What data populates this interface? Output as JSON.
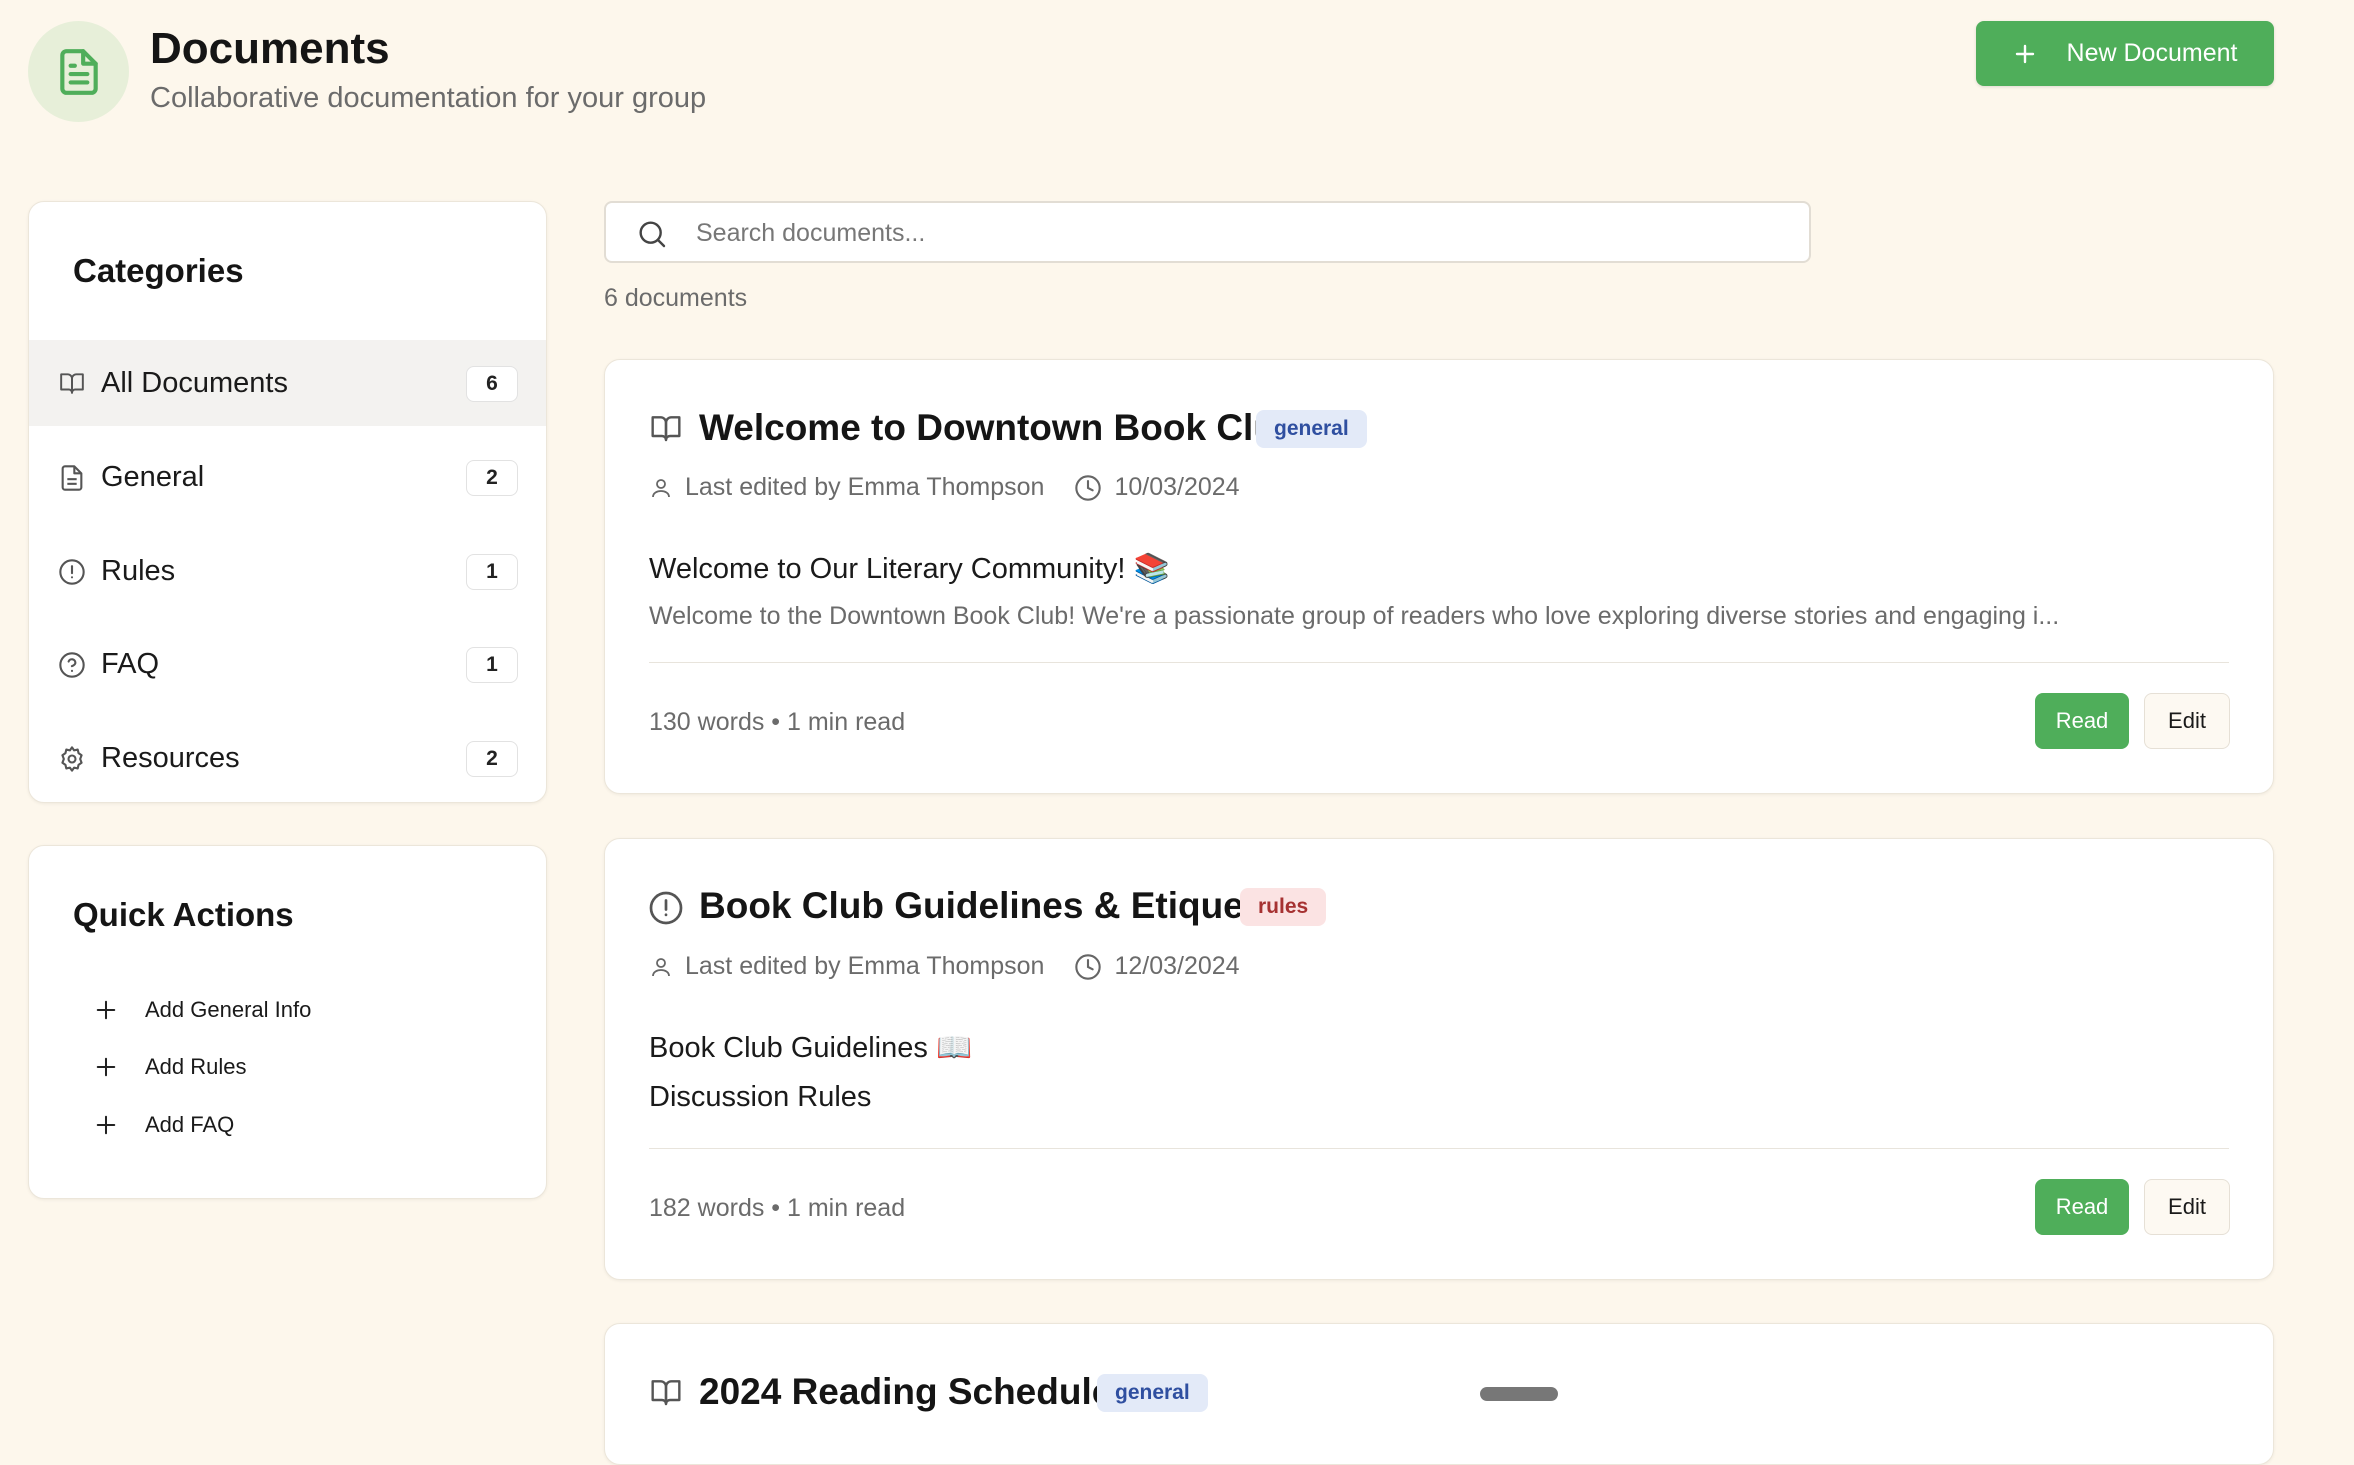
{
  "header": {
    "title": "Documents",
    "subtitle": "Collaborative documentation for your group",
    "icon": "document-icon",
    "new_document_label": "New Document"
  },
  "colors": {
    "accent": "#4fae5a",
    "background": "#fdf7ec",
    "badge_general": "#e3eaf8",
    "badge_rules": "#fbe3e3"
  },
  "categories": {
    "title": "Categories",
    "items": [
      {
        "label": "All Documents",
        "count": "6",
        "icon": "book-open-icon",
        "active": true
      },
      {
        "label": "General",
        "count": "2",
        "icon": "file-text-icon"
      },
      {
        "label": "Rules",
        "count": "1",
        "icon": "alert-circle-icon"
      },
      {
        "label": "FAQ",
        "count": "1",
        "icon": "help-circle-icon"
      },
      {
        "label": "Resources",
        "count": "2",
        "icon": "gear-icon"
      }
    ]
  },
  "quick_actions": {
    "title": "Quick Actions",
    "items": [
      {
        "label": "Add General Info",
        "icon": "plus-icon"
      },
      {
        "label": "Add Rules",
        "icon": "plus-icon"
      },
      {
        "label": "Add FAQ",
        "icon": "plus-icon"
      }
    ]
  },
  "search": {
    "placeholder": "Search documents...",
    "value": ""
  },
  "doc_count": "6 documents",
  "documents": [
    {
      "title": "Welcome to Downtown Book Club",
      "category": "general",
      "icon": "book-open-icon",
      "editor": "Last edited by Emma Thompson",
      "date": "10/03/2024",
      "heading": "Welcome to Our Literary Community! 📚",
      "excerpt": "Welcome to the Downtown Book Club! We're a passionate group of readers who love exploring diverse stories and engaging i...",
      "stats": "130 words • 1 min read",
      "read_label": "Read",
      "edit_label": "Edit"
    },
    {
      "title": "Book Club Guidelines & Etiquette",
      "category": "rules",
      "icon": "alert-circle-icon",
      "editor": "Last edited by Emma Thompson",
      "date": "12/03/2024",
      "heading": "Book Club Guidelines 📖",
      "heading2": "Discussion Rules",
      "stats": "182 words • 1 min read",
      "read_label": "Read",
      "edit_label": "Edit"
    },
    {
      "title": "2024 Reading Schedule",
      "category": "general",
      "icon": "book-open-icon"
    }
  ]
}
